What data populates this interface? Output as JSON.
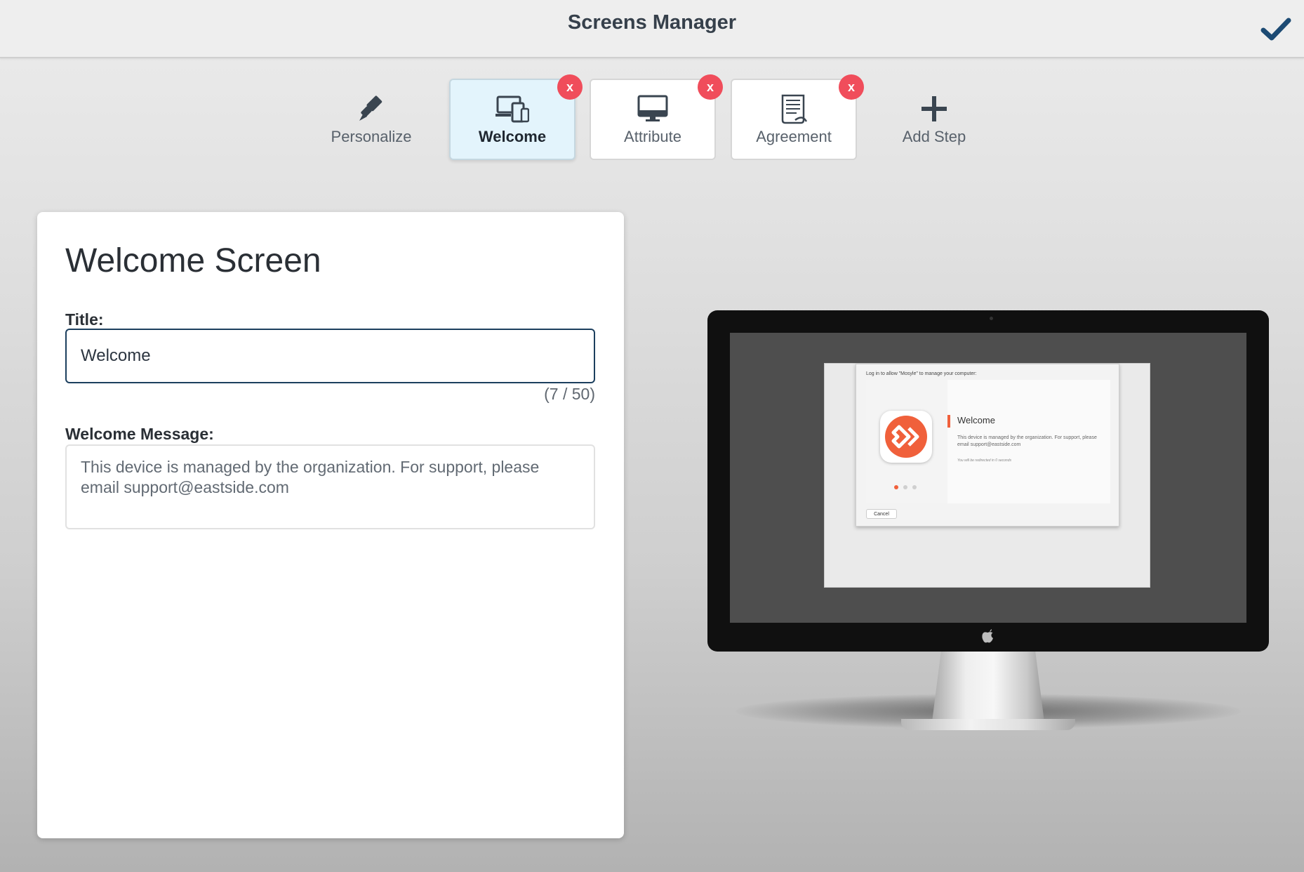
{
  "header": {
    "title": "Screens Manager",
    "confirm_icon": "checkmark-icon",
    "accent_color": "#1c4a73"
  },
  "steps": [
    {
      "label": "Personalize",
      "icon": "paintbrush-icon",
      "state": "plain",
      "removable": false
    },
    {
      "label": "Welcome",
      "icon": "devices-icon",
      "state": "active",
      "removable": true
    },
    {
      "label": "Attribute",
      "icon": "monitor-icon",
      "state": "card",
      "removable": true
    },
    {
      "label": "Agreement",
      "icon": "document-icon",
      "state": "card",
      "removable": true
    },
    {
      "label": "Add Step",
      "icon": "plus-icon",
      "state": "plain",
      "removable": false
    }
  ],
  "remove_badge": {
    "label": "x",
    "color": "#f04d5b"
  },
  "form": {
    "heading": "Welcome Screen",
    "title_label": "Title:",
    "title_value": "Welcome",
    "title_counter": "(7 / 50)",
    "message_label": "Welcome Message:",
    "message_value": "This device is managed by the organization. For support, please email support@eastside.com"
  },
  "preview": {
    "prompt": "Log in to allow \"Mosyle\" to manage your computer:",
    "heading": "Welcome",
    "body": "This device is managed by the organization. For support, please email support@eastside.com",
    "redirect": "You will be redirected in 0 seconds",
    "cancel": "Cancel",
    "brand_color": "#f0603b"
  }
}
